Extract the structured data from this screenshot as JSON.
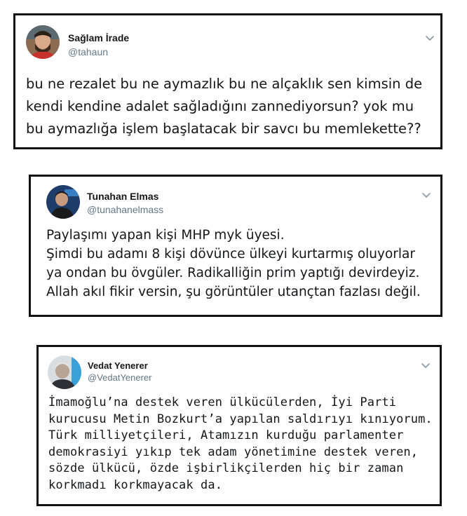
{
  "tweets": [
    {
      "name": "Sağlam İrade",
      "handle": "@tahaun",
      "text": "bu ne rezalet bu ne aymazlık bu ne alçaklık sen kimsin de\nkendi kendine adalet sağladığını zannediyorsun? yok mu\nbu aymazlığa işlem başlatacak bir savcı bu memlekette??"
    },
    {
      "name": "Tunahan Elmas",
      "handle": "@tunahanelmass",
      "text": "Paylaşımı yapan kişi MHP myk üyesi.\nŞimdi bu adamı 8 kişi dövünce ülkeyi kurtarmış oluyorlar\nya ondan bu övgüler. Radikalliğin prim yaptığı devirdeyiz.\nAllah akıl fikir versin, şu görüntüler utançtan fazlası değil."
    },
    {
      "name": "Vedat Yenerer",
      "handle": "@VedatYenerer",
      "text": "İmamoğlu’na destek veren ülkücülerden, İyi Parti\nkurucusu Metin Bozkurt’a yapılan saldırıyı kınıyorum.\nTürk milliyetçileri, Atamızın kurduğu parlamenter\ndemokrasiyi yıkıp tek adam yönetimine destek veren,\nsözde ülkücü, özde işbirlikçilerden hiç bir zaman\nkorkmadı korkmayacak da."
    }
  ],
  "icons": {
    "menu": "chevron-down-icon",
    "avatar": "avatar"
  }
}
